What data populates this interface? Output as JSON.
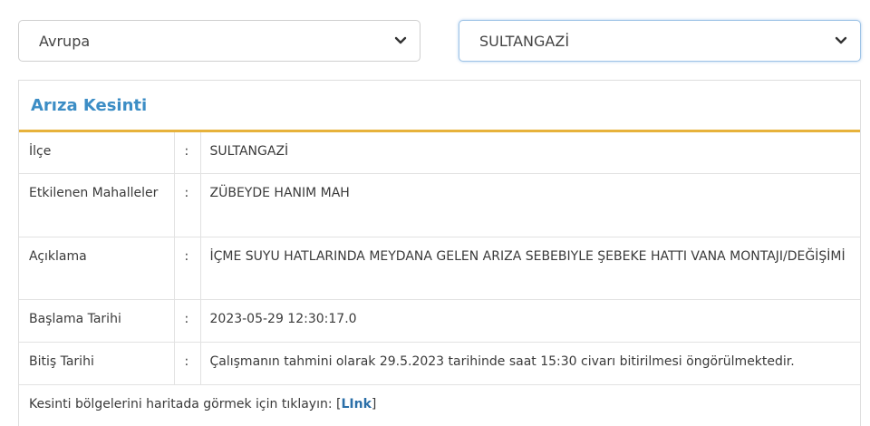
{
  "filters": {
    "region": {
      "selected": "Avrupa"
    },
    "district": {
      "selected": "SULTANGAZİ"
    }
  },
  "panel": {
    "title": "Arıza Kesinti",
    "separator": ":",
    "rows": [
      {
        "label": "İlçe",
        "value": "SULTANGAZİ"
      },
      {
        "label": "Etkilenen Mahalleler",
        "value": "ZÜBEYDE HANIM MAH"
      },
      {
        "label": "Açıklama",
        "value": "İÇME SUYU HATLARINDA MEYDANA GELEN ARIZA SEBEBIYLE ŞEBEKE HATTI VANA MONTAJI/DEĞİŞİMİ"
      },
      {
        "label": "Başlama Tarihi",
        "value": "2023-05-29 12:30:17.0"
      },
      {
        "label": "Bitiş Tarihi",
        "value": "Çalışmanın tahmini olarak 29.5.2023 tarihinde saat 15:30 civarı bitirilmesi öngörülmektedir."
      }
    ],
    "footer": {
      "text": "Kesinti bölgelerini haritada görmek için tıklayın: ",
      "open_bracket": "[",
      "link_label": "LInk",
      "close_bracket": "]"
    }
  },
  "colors": {
    "accent_blue": "#3c8dc5",
    "accent_gold": "#e7b23b",
    "link": "#2b6fa8"
  },
  "icons": [
    "chevron-down-icon"
  ]
}
